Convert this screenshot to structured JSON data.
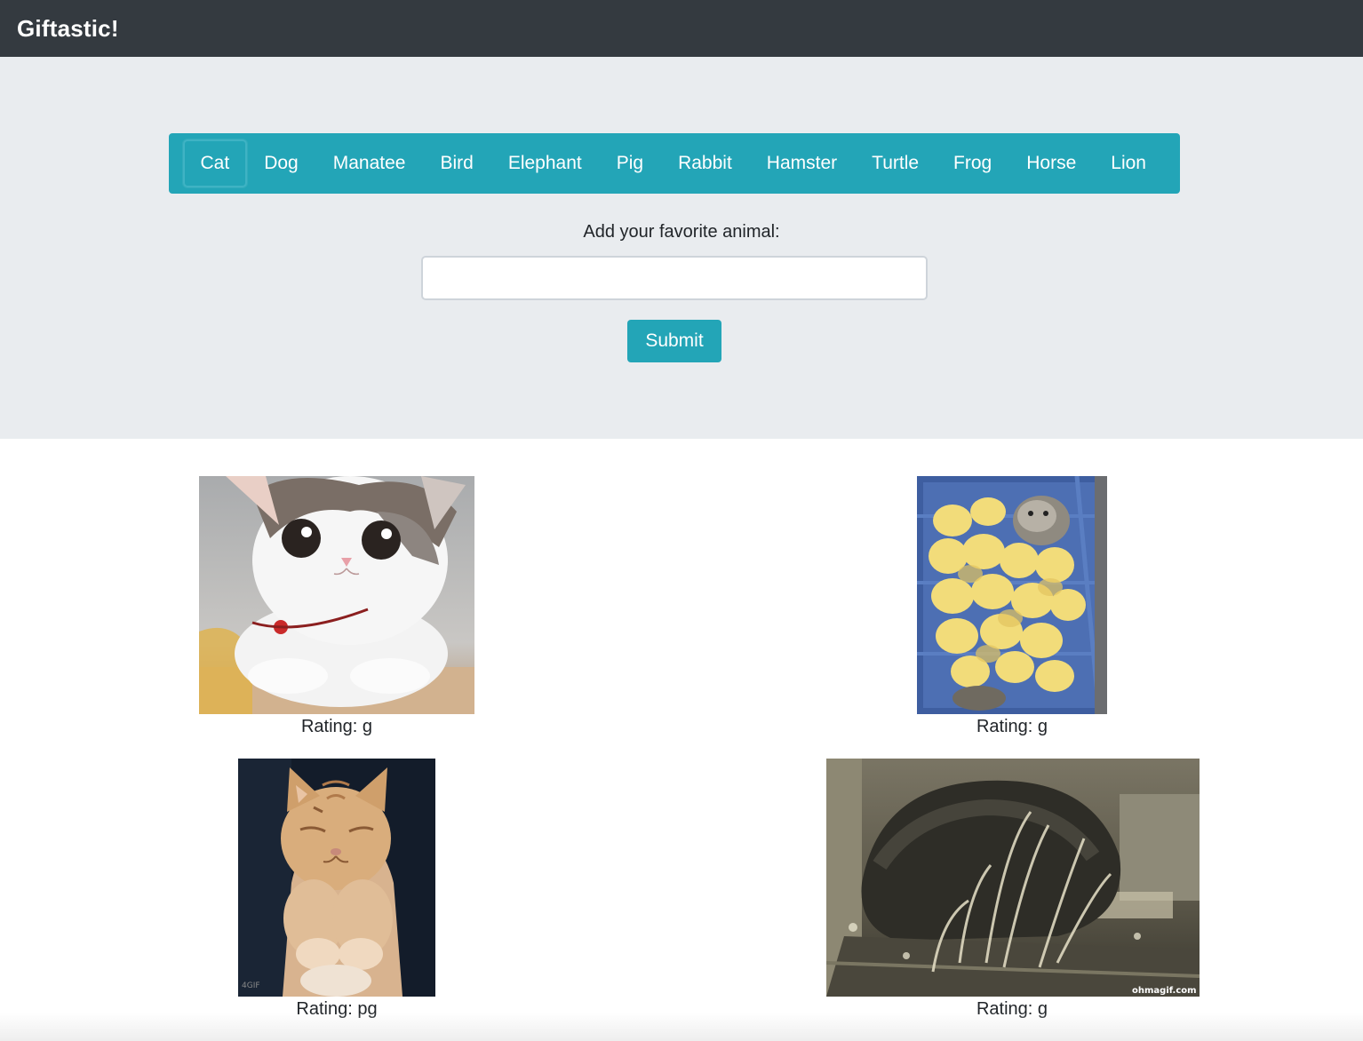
{
  "navbar": {
    "brand": "Giftastic!"
  },
  "animals": [
    "Cat",
    "Dog",
    "Manatee",
    "Bird",
    "Elephant",
    "Pig",
    "Rabbit",
    "Hamster",
    "Turtle",
    "Frog",
    "Horse",
    "Lion"
  ],
  "active_animal": "Cat",
  "form": {
    "label": "Add your favorite animal:",
    "input_value": "",
    "submit_label": "Submit"
  },
  "gifs": [
    {
      "subject": "white-cat",
      "rating_text": "Rating: g"
    },
    {
      "subject": "chicks-in-crate",
      "rating_text": "Rating: g"
    },
    {
      "subject": "orange-kitten",
      "rating_text": "Rating: pg"
    },
    {
      "subject": "cat-in-fountain",
      "rating_text": "Rating: g",
      "watermark": "ohmagif.com"
    }
  ],
  "colors": {
    "navbar": "#343a40",
    "jumbotron": "#e9ecef",
    "accent": "#23a5b7"
  }
}
